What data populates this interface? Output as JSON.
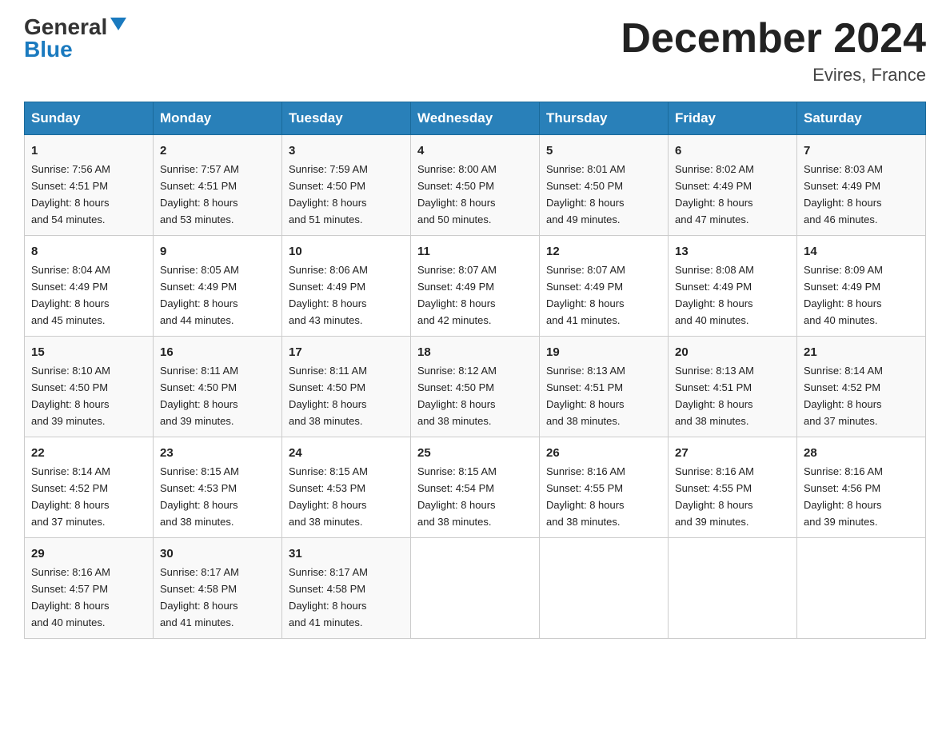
{
  "header": {
    "logo_general": "General",
    "logo_blue": "Blue",
    "month_title": "December 2024",
    "location": "Evires, France"
  },
  "days_of_week": [
    "Sunday",
    "Monday",
    "Tuesday",
    "Wednesday",
    "Thursday",
    "Friday",
    "Saturday"
  ],
  "weeks": [
    [
      {
        "day": "1",
        "sunrise": "7:56 AM",
        "sunset": "4:51 PM",
        "daylight": "8 hours and 54 minutes."
      },
      {
        "day": "2",
        "sunrise": "7:57 AM",
        "sunset": "4:51 PM",
        "daylight": "8 hours and 53 minutes."
      },
      {
        "day": "3",
        "sunrise": "7:59 AM",
        "sunset": "4:50 PM",
        "daylight": "8 hours and 51 minutes."
      },
      {
        "day": "4",
        "sunrise": "8:00 AM",
        "sunset": "4:50 PM",
        "daylight": "8 hours and 50 minutes."
      },
      {
        "day": "5",
        "sunrise": "8:01 AM",
        "sunset": "4:50 PM",
        "daylight": "8 hours and 49 minutes."
      },
      {
        "day": "6",
        "sunrise": "8:02 AM",
        "sunset": "4:49 PM",
        "daylight": "8 hours and 47 minutes."
      },
      {
        "day": "7",
        "sunrise": "8:03 AM",
        "sunset": "4:49 PM",
        "daylight": "8 hours and 46 minutes."
      }
    ],
    [
      {
        "day": "8",
        "sunrise": "8:04 AM",
        "sunset": "4:49 PM",
        "daylight": "8 hours and 45 minutes."
      },
      {
        "day": "9",
        "sunrise": "8:05 AM",
        "sunset": "4:49 PM",
        "daylight": "8 hours and 44 minutes."
      },
      {
        "day": "10",
        "sunrise": "8:06 AM",
        "sunset": "4:49 PM",
        "daylight": "8 hours and 43 minutes."
      },
      {
        "day": "11",
        "sunrise": "8:07 AM",
        "sunset": "4:49 PM",
        "daylight": "8 hours and 42 minutes."
      },
      {
        "day": "12",
        "sunrise": "8:07 AM",
        "sunset": "4:49 PM",
        "daylight": "8 hours and 41 minutes."
      },
      {
        "day": "13",
        "sunrise": "8:08 AM",
        "sunset": "4:49 PM",
        "daylight": "8 hours and 40 minutes."
      },
      {
        "day": "14",
        "sunrise": "8:09 AM",
        "sunset": "4:49 PM",
        "daylight": "8 hours and 40 minutes."
      }
    ],
    [
      {
        "day": "15",
        "sunrise": "8:10 AM",
        "sunset": "4:50 PM",
        "daylight": "8 hours and 39 minutes."
      },
      {
        "day": "16",
        "sunrise": "8:11 AM",
        "sunset": "4:50 PM",
        "daylight": "8 hours and 39 minutes."
      },
      {
        "day": "17",
        "sunrise": "8:11 AM",
        "sunset": "4:50 PM",
        "daylight": "8 hours and 38 minutes."
      },
      {
        "day": "18",
        "sunrise": "8:12 AM",
        "sunset": "4:50 PM",
        "daylight": "8 hours and 38 minutes."
      },
      {
        "day": "19",
        "sunrise": "8:13 AM",
        "sunset": "4:51 PM",
        "daylight": "8 hours and 38 minutes."
      },
      {
        "day": "20",
        "sunrise": "8:13 AM",
        "sunset": "4:51 PM",
        "daylight": "8 hours and 38 minutes."
      },
      {
        "day": "21",
        "sunrise": "8:14 AM",
        "sunset": "4:52 PM",
        "daylight": "8 hours and 37 minutes."
      }
    ],
    [
      {
        "day": "22",
        "sunrise": "8:14 AM",
        "sunset": "4:52 PM",
        "daylight": "8 hours and 37 minutes."
      },
      {
        "day": "23",
        "sunrise": "8:15 AM",
        "sunset": "4:53 PM",
        "daylight": "8 hours and 38 minutes."
      },
      {
        "day": "24",
        "sunrise": "8:15 AM",
        "sunset": "4:53 PM",
        "daylight": "8 hours and 38 minutes."
      },
      {
        "day": "25",
        "sunrise": "8:15 AM",
        "sunset": "4:54 PM",
        "daylight": "8 hours and 38 minutes."
      },
      {
        "day": "26",
        "sunrise": "8:16 AM",
        "sunset": "4:55 PM",
        "daylight": "8 hours and 38 minutes."
      },
      {
        "day": "27",
        "sunrise": "8:16 AM",
        "sunset": "4:55 PM",
        "daylight": "8 hours and 39 minutes."
      },
      {
        "day": "28",
        "sunrise": "8:16 AM",
        "sunset": "4:56 PM",
        "daylight": "8 hours and 39 minutes."
      }
    ],
    [
      {
        "day": "29",
        "sunrise": "8:16 AM",
        "sunset": "4:57 PM",
        "daylight": "8 hours and 40 minutes."
      },
      {
        "day": "30",
        "sunrise": "8:17 AM",
        "sunset": "4:58 PM",
        "daylight": "8 hours and 41 minutes."
      },
      {
        "day": "31",
        "sunrise": "8:17 AM",
        "sunset": "4:58 PM",
        "daylight": "8 hours and 41 minutes."
      },
      null,
      null,
      null,
      null
    ]
  ],
  "labels": {
    "sunrise": "Sunrise:",
    "sunset": "Sunset:",
    "daylight": "Daylight:"
  }
}
